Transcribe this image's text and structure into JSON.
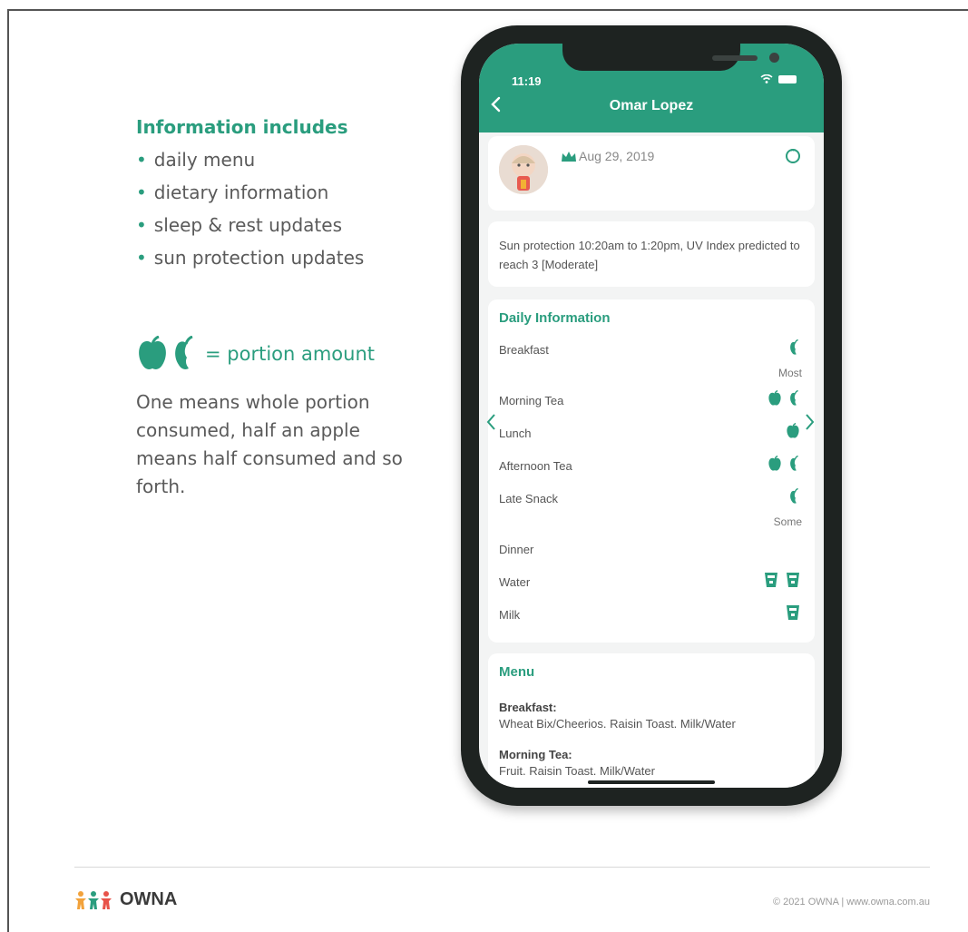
{
  "info": {
    "heading": "Information includes",
    "bullets": [
      "daily menu",
      "dietary information",
      "sleep & rest updates",
      "sun protection updates"
    ],
    "portion_label": "= portion amount",
    "description": "One means whole portion consumed, half an apple means half consumed and so forth."
  },
  "phone": {
    "time": "11:19",
    "title": "Omar Lopez",
    "post_date": "Aug 29, 2019",
    "sun_note": "Sun protection 10:20am to 1:20pm, UV Index predicted to reach 3 [Moderate]",
    "daily": {
      "title": "Daily Information",
      "rows": [
        {
          "label": "Breakfast",
          "icons": [
            "half-apple"
          ],
          "note": "Most"
        },
        {
          "label": "Morning Tea",
          "icons": [
            "apple",
            "half-apple"
          ]
        },
        {
          "label": "Lunch",
          "icons": [
            "apple"
          ]
        },
        {
          "label": "Afternoon Tea",
          "icons": [
            "apple",
            "half-apple"
          ]
        },
        {
          "label": "Late Snack",
          "icons": [
            "half-apple"
          ],
          "note": "Some"
        },
        {
          "label": "Dinner",
          "icons": []
        },
        {
          "label": "Water",
          "icons": [
            "cup",
            "cup"
          ]
        },
        {
          "label": "Milk",
          "icons": [
            "cup"
          ]
        }
      ]
    },
    "menu": {
      "title": "Menu",
      "items": [
        {
          "heading": "Breakfast:",
          "text": "Wheat Bix/Cheerios. Raisin Toast. Milk/Water"
        },
        {
          "heading": "Morning Tea:",
          "text": "Fruit. Raisin Toast. Milk/Water"
        }
      ]
    }
  },
  "footer": {
    "logo": "OWNA",
    "copyright": "© 2021 OWNA | www.owna.com.au"
  },
  "colors": {
    "accent": "#2a9d7e",
    "phone_body": "#1e2321"
  }
}
